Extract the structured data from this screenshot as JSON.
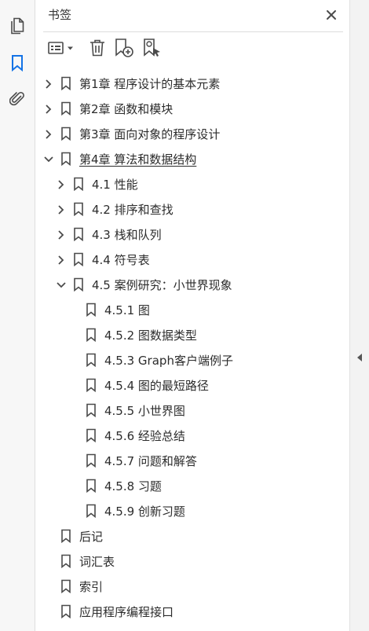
{
  "panel": {
    "title": "书签"
  },
  "icons": {
    "rail": [
      "pages-icon",
      "bookmark-icon",
      "paperclip-icon"
    ],
    "toolbar": [
      "options-menu-icon",
      "delete-icon",
      "new-bookmark-icon",
      "find-bookmark-icon"
    ]
  },
  "colors": {
    "accent": "#1473e6",
    "icon": "#4b4b4b"
  },
  "tree": [
    {
      "label": "第1章  程序设计的基本元素",
      "level": 0,
      "expander": "collapsed"
    },
    {
      "label": "第2章  函数和模块",
      "level": 0,
      "expander": "collapsed"
    },
    {
      "label": "第3章  面向对象的程序设计",
      "level": 0,
      "expander": "collapsed"
    },
    {
      "label": "第4章  算法和数据结构",
      "level": 0,
      "expander": "expanded",
      "current": true
    },
    {
      "label": "4.1  性能",
      "level": 1,
      "expander": "collapsed"
    },
    {
      "label": "4.2  排序和查找",
      "level": 1,
      "expander": "collapsed"
    },
    {
      "label": "4.3  栈和队列",
      "level": 1,
      "expander": "collapsed"
    },
    {
      "label": "4.4  符号表",
      "level": 1,
      "expander": "collapsed"
    },
    {
      "label": "4.5  案例研究：小世界现象",
      "level": 1,
      "expander": "expanded"
    },
    {
      "label": "4.5.1  图",
      "level": 2,
      "expander": "none"
    },
    {
      "label": "4.5.2  图数据类型",
      "level": 2,
      "expander": "none"
    },
    {
      "label": "4.5.3  Graph客户端例子",
      "level": 2,
      "expander": "none"
    },
    {
      "label": "4.5.4  图的最短路径",
      "level": 2,
      "expander": "none"
    },
    {
      "label": "4.5.5  小世界图",
      "level": 2,
      "expander": "none"
    },
    {
      "label": "4.5.6  经验总结",
      "level": 2,
      "expander": "none"
    },
    {
      "label": "4.5.7  问题和解答",
      "level": 2,
      "expander": "none"
    },
    {
      "label": "4.5.8  习题",
      "level": 2,
      "expander": "none"
    },
    {
      "label": "4.5.9  创新习题",
      "level": 2,
      "expander": "none"
    },
    {
      "label": "后记",
      "level": 0,
      "expander": "none"
    },
    {
      "label": "词汇表",
      "level": 0,
      "expander": "none"
    },
    {
      "label": "索引",
      "level": 0,
      "expander": "none"
    },
    {
      "label": "应用程序编程接口",
      "level": 0,
      "expander": "none"
    }
  ]
}
